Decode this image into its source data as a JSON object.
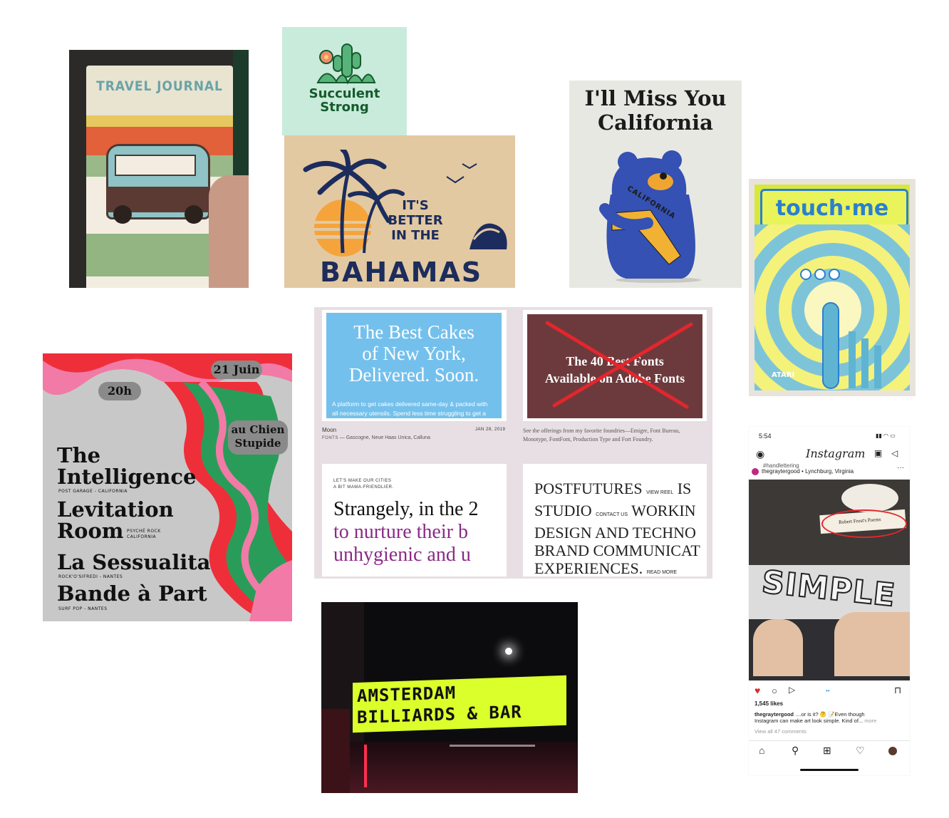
{
  "travel_journal": {
    "title": "TRAVEL JOURNAL"
  },
  "succulent": {
    "line1": "Succulent",
    "line2": "Strong"
  },
  "bahamas": {
    "line1": "IT'S",
    "line2": "BETTER",
    "line3": "IN THE",
    "big": "BAHAMAS"
  },
  "california": {
    "line1": "I'll Miss You",
    "line2": "California",
    "state": "CALIFORNIA"
  },
  "touchme": {
    "title": "touch·me",
    "brand": "ATARI"
  },
  "poster": {
    "date": "21 Juin",
    "time": "20h",
    "venue_line1": "au Chien",
    "venue_line2": "Stupide",
    "acts": [
      {
        "name": "The",
        "name2": "Intelligence",
        "sub": "POST GARAGE - CALIFORNIA"
      },
      {
        "name": "Levitation",
        "name2": "Room",
        "sub": "PSYCHÉ ROCK",
        "sub2": "CALIFORNIA"
      },
      {
        "name": "La Sessualita",
        "sub": "ROCK'O'SIFREDI - NANTES"
      },
      {
        "name": "Bande à Part",
        "sub": "SURF POP - NANTES"
      }
    ]
  },
  "web": {
    "cakes": {
      "headline": [
        "The Best Cakes",
        "of New York,",
        "Delivered. Soon."
      ],
      "body": [
        "A platform to get cakes delivered same-day & packed with",
        "all necessary utensils. Spend less time struggling to get a"
      ],
      "caption_left": "Moon",
      "caption_date": "JAN 28, 2019",
      "fonts_label": "FONTS",
      "fonts_value": "— Gascogne, Neue Haas Unica, Calluna"
    },
    "adobe": {
      "headline": [
        "The 40 Best Fonts",
        "Available on Adobe Fonts"
      ],
      "caption": [
        "See the offerings from my favorite foundries—Emigre, Font Bureau,",
        "Monotype, FontFont, Production Type and Fort Foundry."
      ]
    },
    "cities": {
      "kicker": [
        "LET'S MAKE OUR CITIES",
        "A BIT MAMA-FRIENDLIER."
      ],
      "line1": "Strangely, in the 2",
      "line2": "to nurture their b",
      "line3": "unhygienic and u"
    },
    "postfutures": {
      "l1": "POSTFUTURES",
      "l1_small": "VIEW REEL",
      "l1_end": "IS",
      "l2": "STUDIO",
      "l2_small": "CONTACT US",
      "l2_end": "WORKIN",
      "l3": "DESIGN AND TECHNO",
      "l4": "BRAND COMMUNICAT",
      "l5": "EXPERIENCES.",
      "l5_small": "READ MORE"
    }
  },
  "amsterdam": {
    "line1": "AMSTERDAM",
    "line2": "BILLIARDS & BAR"
  },
  "instagram": {
    "time": "5:54",
    "app_title": "Instagram",
    "hashtag": "#handlettering",
    "username": "thegraytergood",
    "location": "Lynchburg, Virginia",
    "photo_word": "SIMPLE",
    "book_title": "Robert Frost's Poems",
    "likes": "1,545 likes",
    "caption_user": "thegraytergood",
    "caption_text": "....or is it? 🤔 📝Even though",
    "caption_text2": "Instagram can make art look simple. Kind of...",
    "more": "more",
    "comments": "View all 47 comments"
  },
  "colors": {
    "navy": "#1c2c5c",
    "cake_blue": "#74c0ec",
    "adobe_maroon": "#6c3a3d",
    "cross_red": "#e3262c",
    "purple": "#8a2a86",
    "neon": "#dbff2a"
  }
}
